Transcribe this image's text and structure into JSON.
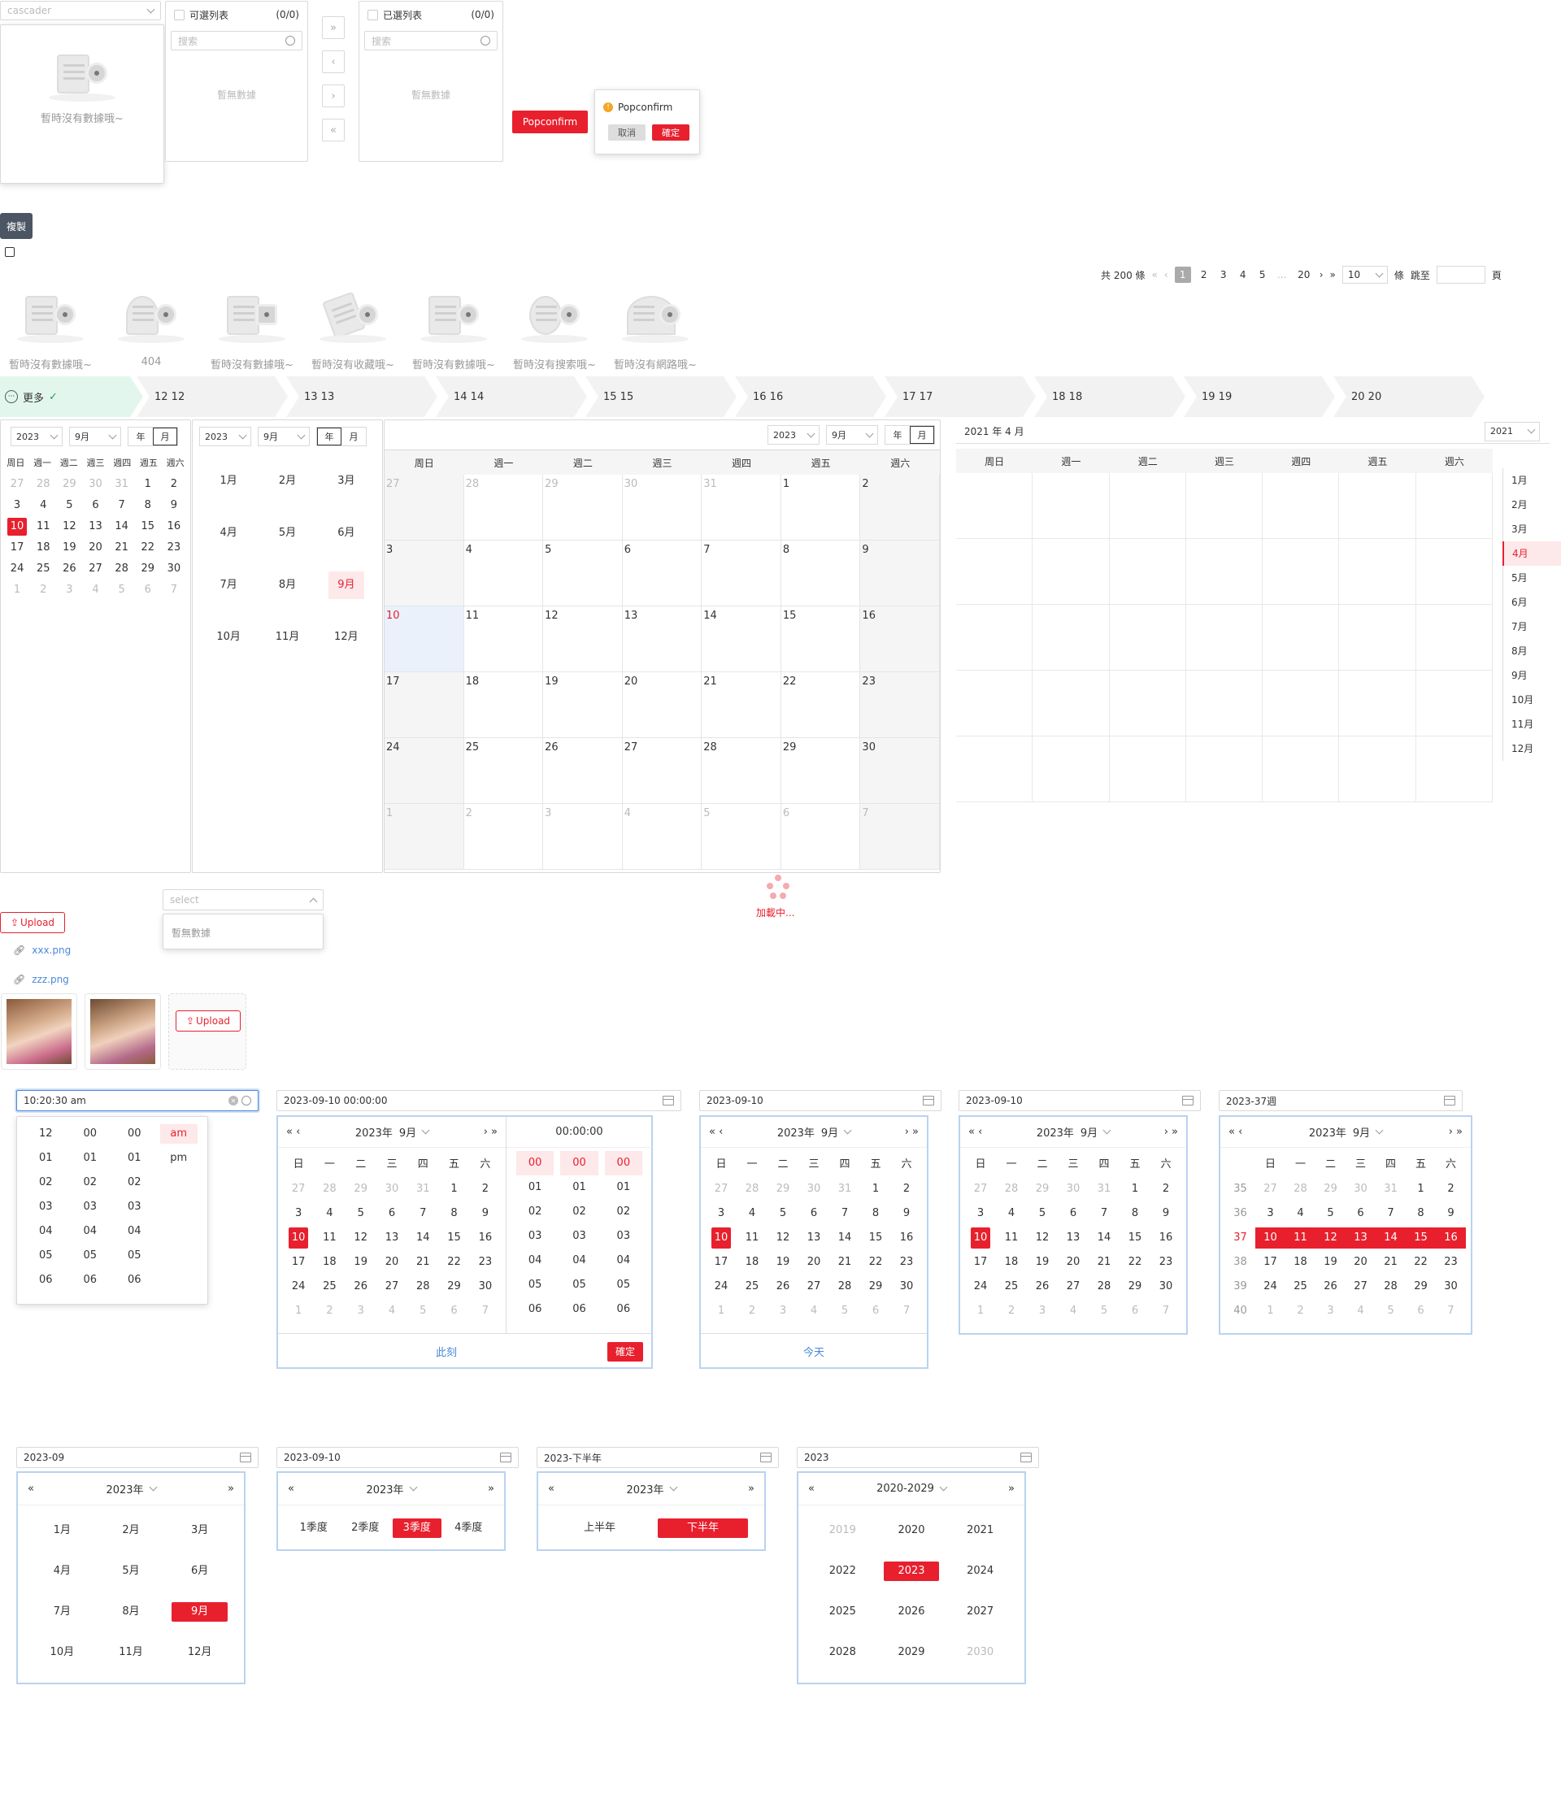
{
  "cascader": {
    "placeholder": "cascader",
    "empty": "暫時沒有數據哦~"
  },
  "transfer": {
    "left_title": "可選列表",
    "left_count": "(0/0)",
    "right_title": "已選列表",
    "right_count": "(0/0)",
    "search_placeholder": "搜索",
    "empty": "暫無數據",
    "btns": [
      "»",
      "‹",
      "›",
      "«"
    ]
  },
  "popconfirm": {
    "button": "Popconfirm",
    "title": "Popconfirm",
    "cancel": "取消",
    "ok": "確定"
  },
  "copy": {
    "tooltip": "複製"
  },
  "pagination": {
    "total": "共 200 條",
    "pages": [
      "1",
      "2",
      "3",
      "4",
      "5",
      "...",
      "20"
    ],
    "current": "1",
    "size": "10",
    "size_unit": "條",
    "jump": "跳至",
    "page_unit": "頁"
  },
  "empties": [
    "暫時沒有數據哦~",
    "404",
    "暫時沒有數據哦~",
    "暫時沒有收藏哦~",
    "暫時沒有數據哦~",
    "暫時沒有搜索哦~",
    "暫時沒有網路哦~"
  ],
  "steps": {
    "first": "更多",
    "items": [
      "12 12",
      "13 13",
      "14 14",
      "15 15",
      "16 16",
      "17 17",
      "18 18",
      "19 19",
      "20 20"
    ]
  },
  "cal_small": {
    "year": "2023",
    "month": "9月",
    "mode_year": "年",
    "mode_month": "月",
    "weekdays": [
      "周日",
      "週一",
      "週二",
      "週三",
      "週四",
      "週五",
      "週六"
    ],
    "days": [
      [
        "27",
        "g"
      ],
      [
        "28",
        "g"
      ],
      [
        "29",
        "g"
      ],
      [
        "30",
        "g"
      ],
      [
        "31",
        "g"
      ],
      [
        "1",
        ""
      ],
      [
        "2",
        ""
      ],
      [
        "3",
        ""
      ],
      [
        "4",
        ""
      ],
      [
        "5",
        ""
      ],
      [
        "6",
        ""
      ],
      [
        "7",
        ""
      ],
      [
        "8",
        ""
      ],
      [
        "9",
        ""
      ],
      [
        "10",
        "t"
      ],
      [
        "11",
        ""
      ],
      [
        "12",
        ""
      ],
      [
        "13",
        ""
      ],
      [
        "14",
        ""
      ],
      [
        "15",
        ""
      ],
      [
        "16",
        ""
      ],
      [
        "17",
        ""
      ],
      [
        "18",
        ""
      ],
      [
        "19",
        ""
      ],
      [
        "20",
        ""
      ],
      [
        "21",
        ""
      ],
      [
        "22",
        ""
      ],
      [
        "23",
        ""
      ],
      [
        "24",
        ""
      ],
      [
        "25",
        ""
      ],
      [
        "26",
        ""
      ],
      [
        "27",
        ""
      ],
      [
        "28",
        ""
      ],
      [
        "29",
        ""
      ],
      [
        "30",
        ""
      ],
      [
        "1",
        "g"
      ],
      [
        "2",
        "g"
      ],
      [
        "3",
        "g"
      ],
      [
        "4",
        "g"
      ],
      [
        "5",
        "g"
      ],
      [
        "6",
        "g"
      ],
      [
        "7",
        "g"
      ]
    ]
  },
  "cal_month": {
    "year": "2023",
    "month": "9月",
    "mode_year": "年",
    "mode_month": "月",
    "months": [
      "1月",
      "2月",
      "3月",
      "4月",
      "5月",
      "6月",
      "7月",
      "8月",
      "9月",
      "10月",
      "11月",
      "12月"
    ],
    "selected": "9月"
  },
  "cal_big": {
    "year": "2023",
    "month": "9月",
    "mode_year": "年",
    "mode_month": "月",
    "weekdays": [
      "周日",
      "週一",
      "週二",
      "週三",
      "週四",
      "週五",
      "週六"
    ]
  },
  "cal_right": {
    "title": "2021 年 4 月",
    "year": "2021",
    "weekdays": [
      "周日",
      "週一",
      "週二",
      "週三",
      "週四",
      "週五",
      "週六"
    ],
    "months": [
      "1月",
      "2月",
      "3月",
      "4月",
      "5月",
      "6月",
      "7月",
      "8月",
      "9月",
      "10月",
      "11月",
      "12月"
    ],
    "selected": "4月"
  },
  "select": {
    "placeholder": "select",
    "empty": "暫無數據"
  },
  "loading": {
    "text": "加載中..."
  },
  "upload": {
    "button": "Upload",
    "files": [
      "xxx.png",
      "zzz.png"
    ]
  },
  "timepicker": {
    "value": "10:20:30 am",
    "h": [
      "12",
      "01",
      "02",
      "03",
      "04",
      "05",
      "06"
    ],
    "m": [
      "00",
      "01",
      "02",
      "03",
      "04",
      "05",
      "06"
    ],
    "s": [
      "00",
      "01",
      "02",
      "03",
      "04",
      "05",
      "06"
    ],
    "ampm": [
      "am",
      "pm"
    ]
  },
  "dtpicker": {
    "value": "2023-09-10 00:00:00",
    "year": "2023年",
    "month": "9月",
    "time": "00:00:00",
    "now": "此刻",
    "ok": "確定",
    "cols": [
      "00",
      "01",
      "02",
      "03",
      "04",
      "05",
      "06"
    ]
  },
  "weekdays_short": [
    "日",
    "一",
    "二",
    "三",
    "四",
    "五",
    "六"
  ],
  "datepicker": {
    "value": "2023-09-10",
    "today": "今天"
  },
  "datepicker2": {
    "value": "2023-09-10"
  },
  "weekpicker": {
    "value": "2023-37週",
    "weeks": [
      "35",
      "36",
      "37",
      "38",
      "39",
      "40"
    ]
  },
  "monthpicker": {
    "value": "2023-09",
    "year": "2023年",
    "months": [
      "1月",
      "2月",
      "3月",
      "4月",
      "5月",
      "6月",
      "7月",
      "8月",
      "9月",
      "10月",
      "11月",
      "12月"
    ],
    "selected": "9月"
  },
  "quarterpicker": {
    "value": "2023-09-10",
    "year": "2023年",
    "items": [
      "1季度",
      "2季度",
      "3季度",
      "4季度"
    ],
    "selected": "3季度"
  },
  "halfpicker": {
    "value": "2023-下半年",
    "year": "2023年",
    "items": [
      "上半年",
      "下半年"
    ],
    "selected": "下半年"
  },
  "yearpicker": {
    "value": "2023",
    "range": "2020-2029",
    "years": [
      "2019",
      "2020",
      "2021",
      "2022",
      "2023",
      "2024",
      "2025",
      "2026",
      "2027",
      "2028",
      "2029",
      "2030"
    ],
    "selected": "2023"
  }
}
